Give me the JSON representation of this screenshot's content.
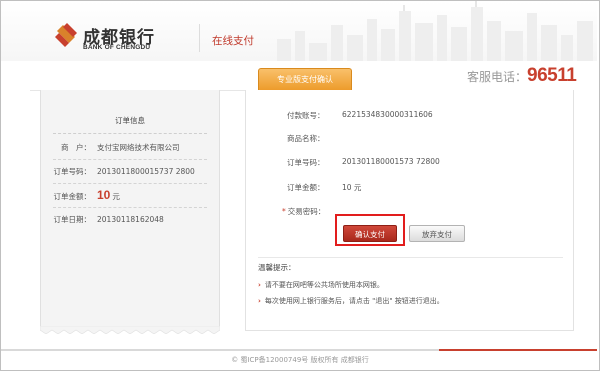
{
  "header": {
    "bank_name_cn": "成都银行",
    "bank_name_en": "BANK OF CHENGDU",
    "page_title": "在线支付",
    "service_label": "客服电话：",
    "service_number": "96511",
    "brand_color": "#c8402e"
  },
  "tab": {
    "label": "专业版支付确认",
    "color": "#ec9a28"
  },
  "order": {
    "title": "订单信息",
    "merchant_label": "商　户：",
    "merchant_value": "支付宝网络技术有限公司",
    "order_no_label": "订单号码：",
    "order_no_value": "2013011800015737 2800",
    "amount_label": "订单金额：",
    "amount_value": "10",
    "amount_unit": "元",
    "date_label": "订单日期：",
    "date_value": "20130118162048"
  },
  "payment": {
    "account_label": "付款账号：",
    "account_value": "6221534830000311606",
    "product_label": "商品名称：",
    "product_value": "",
    "order_no_label": "订单号码：",
    "order_no_value": "201301180001573 72800",
    "amount_label": "订单金额：",
    "amount_value": "10 元",
    "password_required_mark": "*",
    "password_label": "交易密码：",
    "confirm_button": "确认支付",
    "abandon_button": "放弃支付"
  },
  "tips": {
    "title": "温馨提示：",
    "items": [
      "请不要在网吧等公共场所使用本网银。",
      "每次使用网上银行服务后，请点击 \"退出\" 按钮进行退出。"
    ]
  },
  "footer": {
    "text": "© 蜀ICP备12000749号 版权所有 成都银行"
  }
}
